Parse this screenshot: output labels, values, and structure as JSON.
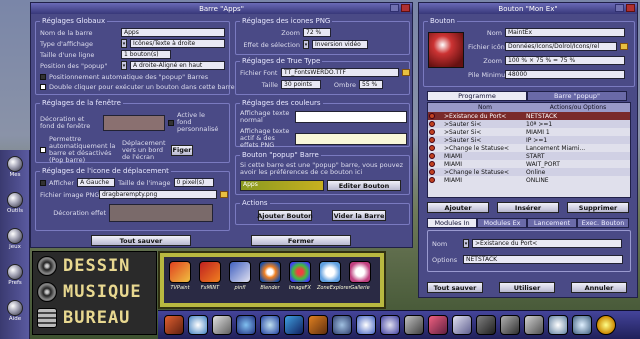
{
  "left_window": {
    "title": "Barre \"Apps\"",
    "sec_global": {
      "title": "Réglages Globaux",
      "nom_label": "Nom de la barre",
      "nom_value": "Apps",
      "type_label": "Type d'affichage",
      "type_value": "Icônes/Texte à droite",
      "taille_label": "Taille d'une ligne",
      "taille_value": "1 bouton(s)",
      "position_label": "Position des \"popup\"",
      "position_value": "A droite-Aligné en haut",
      "check1": "Positionnement automatique des \"popup\" Barres",
      "check2": "Double cliquer pour exécuter un bouton dans cette barre"
    },
    "sec_fond": {
      "title": "Réglages de la fenêtre",
      "decoration_label": "Décoration et fond de fenêtre",
      "active_fond_label": "Active le fond personnalisé",
      "permettre_label": "Permettre automatiquement la barre et désactivés (Pop barre)",
      "deplacement_label": "Déplacement vers un bord de l'écran",
      "fixer_label": "Figer"
    },
    "sec_icone": {
      "title": "Réglages de l'icone de déplacement",
      "afficher_label": "Afficher",
      "afficher_value": "A Gauche",
      "taille_image_label": "Taille de l'image",
      "taille_image_value": "0 pixel(s)",
      "fichier_label": "Fichier image PNG",
      "fichier_value": "dragbarempty.png",
      "deco_label": "Décoration effet"
    },
    "sec_png": {
      "title": "Réglages des icones PNG",
      "zoom_label": "Zoom",
      "zoom_value": "72 %",
      "effet_label": "Effet de sélection",
      "effet_value": "Inversion vidéo"
    },
    "sec_font": {
      "title": "Réglages de True Type",
      "fichier_label": "Fichier Font",
      "fichier_value": "TT_FontsWERDO.TTF",
      "taille_label": "Taille",
      "taille_value": "30 points",
      "ombre_label": "Ombre",
      "ombre_value": "55 %"
    },
    "sec_couleurs": {
      "title": "Réglages des couleurs",
      "texte_normal_label": "Affichage texte normal",
      "texte_actif_label": "Affichage texte actif & des effets PNG"
    },
    "sec_popup": {
      "title": "Bouton \"popup\" Barre",
      "desc": "Si cette barre est une \"popup\" barre, vous pouvez avoir les préférences de ce bouton ici",
      "apps_value": "Apps",
      "editer_button": "Editer Bouton"
    },
    "sec_actions": {
      "title": "Actions",
      "ajouter_button": "Ajouter Bouton",
      "vider_button": "Vider la Barre"
    },
    "tout_sauver": "Tout sauver",
    "fermer": "Fermer"
  },
  "right_window": {
    "title": "Bouton \"Mon Ex\"",
    "bouton_title": "Bouton",
    "nom_label": "Nom",
    "nom_value": "MaintEx",
    "fichier_label": "Fichier icône",
    "fichier_value": "Données/Icons/Dolrol/Icons/rel",
    "zoom_label": "Zoom",
    "zoom_value": "100 % × 75 % = 75 %",
    "pile_label": "Pile Minimum",
    "pile_value": "48000",
    "tabs": [
      "Programme",
      "Barre \"popup\""
    ],
    "list_headers": [
      "Nom",
      "Actions/ou Options"
    ],
    "list_rows": [
      {
        "nom": ">Existance du Port<",
        "action": "NETSTACK",
        "selected": true
      },
      {
        "nom": ">Sauter Si<",
        "action": "10ª >=1",
        "selected": false
      },
      {
        "nom": ">Sauter Si<",
        "action": "MIAMI 1",
        "selected": false
      },
      {
        "nom": ">Sauter Si<",
        "action": "IP >=1",
        "selected": false
      },
      {
        "nom": ">Change le Statuse<",
        "action": "Lancement Miami...",
        "selected": false
      },
      {
        "nom": "MIAMI",
        "action": "START",
        "selected": false
      },
      {
        "nom": "MIAMI",
        "action": "WAIT_PORT",
        "selected": false
      },
      {
        "nom": ">Change le Statuse<",
        "action": "Online",
        "selected": false
      },
      {
        "nom": "MIAMI",
        "action": "ONLINE",
        "selected": false
      }
    ],
    "ajouter": "Ajouter",
    "inserer": "Insérer",
    "supprimer": "Supprimer",
    "subtabs": [
      "Modules In",
      "Modules Ex",
      "Lancement",
      "Exec. Bouton"
    ],
    "sub_nom_label": "Nom",
    "sub_nom_value": ">Existance du Port<",
    "sub_options_label": "Options",
    "sub_options_value": "NETSTACK",
    "tout_sauver": "Tout sauver",
    "utiliser": "Utiliser",
    "annuler": "Annuler"
  },
  "left_dock": [
    "Mes",
    "Outils",
    "Jeux",
    "Prefs",
    "Aide"
  ],
  "menu": [
    "DESSIN",
    "MUSIQUE",
    "BUREAU"
  ],
  "launcher": [
    "TVPaint",
    "FxMINT",
    "pinfl",
    "Blender",
    "ImageFX",
    "ZoneExplorer",
    "Gallerie"
  ]
}
